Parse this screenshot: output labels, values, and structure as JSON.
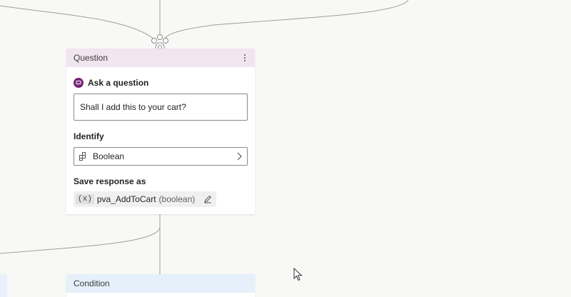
{
  "question_node": {
    "header_title": "Question",
    "ask_label": "Ask a question",
    "question_text": "Shall I add this to your cart?",
    "identify_label": "Identify",
    "identify_value": "Boolean",
    "save_response_label": "Save response as",
    "variable_icon": "(x)",
    "variable_name": "pva_AddToCart",
    "variable_type": "(boolean)"
  },
  "condition_node": {
    "header_title": "Condition"
  },
  "colors": {
    "canvas_bg": "#f8f8f6",
    "question_header_bg": "#f1e5ef",
    "condition_header_bg": "#e6f0fb",
    "ask_icon": "#742774",
    "connector": "#9e9e9e"
  },
  "icons": {
    "ask": "chat-bubble-icon",
    "identify": "entity-icon",
    "identify_chevron": "chevron-right-icon",
    "variable_edit": "pencil-icon",
    "header_menu": "more-vertical-icon",
    "node_connector": "connector-node-icon",
    "pointer": "mouse-cursor-icon"
  }
}
